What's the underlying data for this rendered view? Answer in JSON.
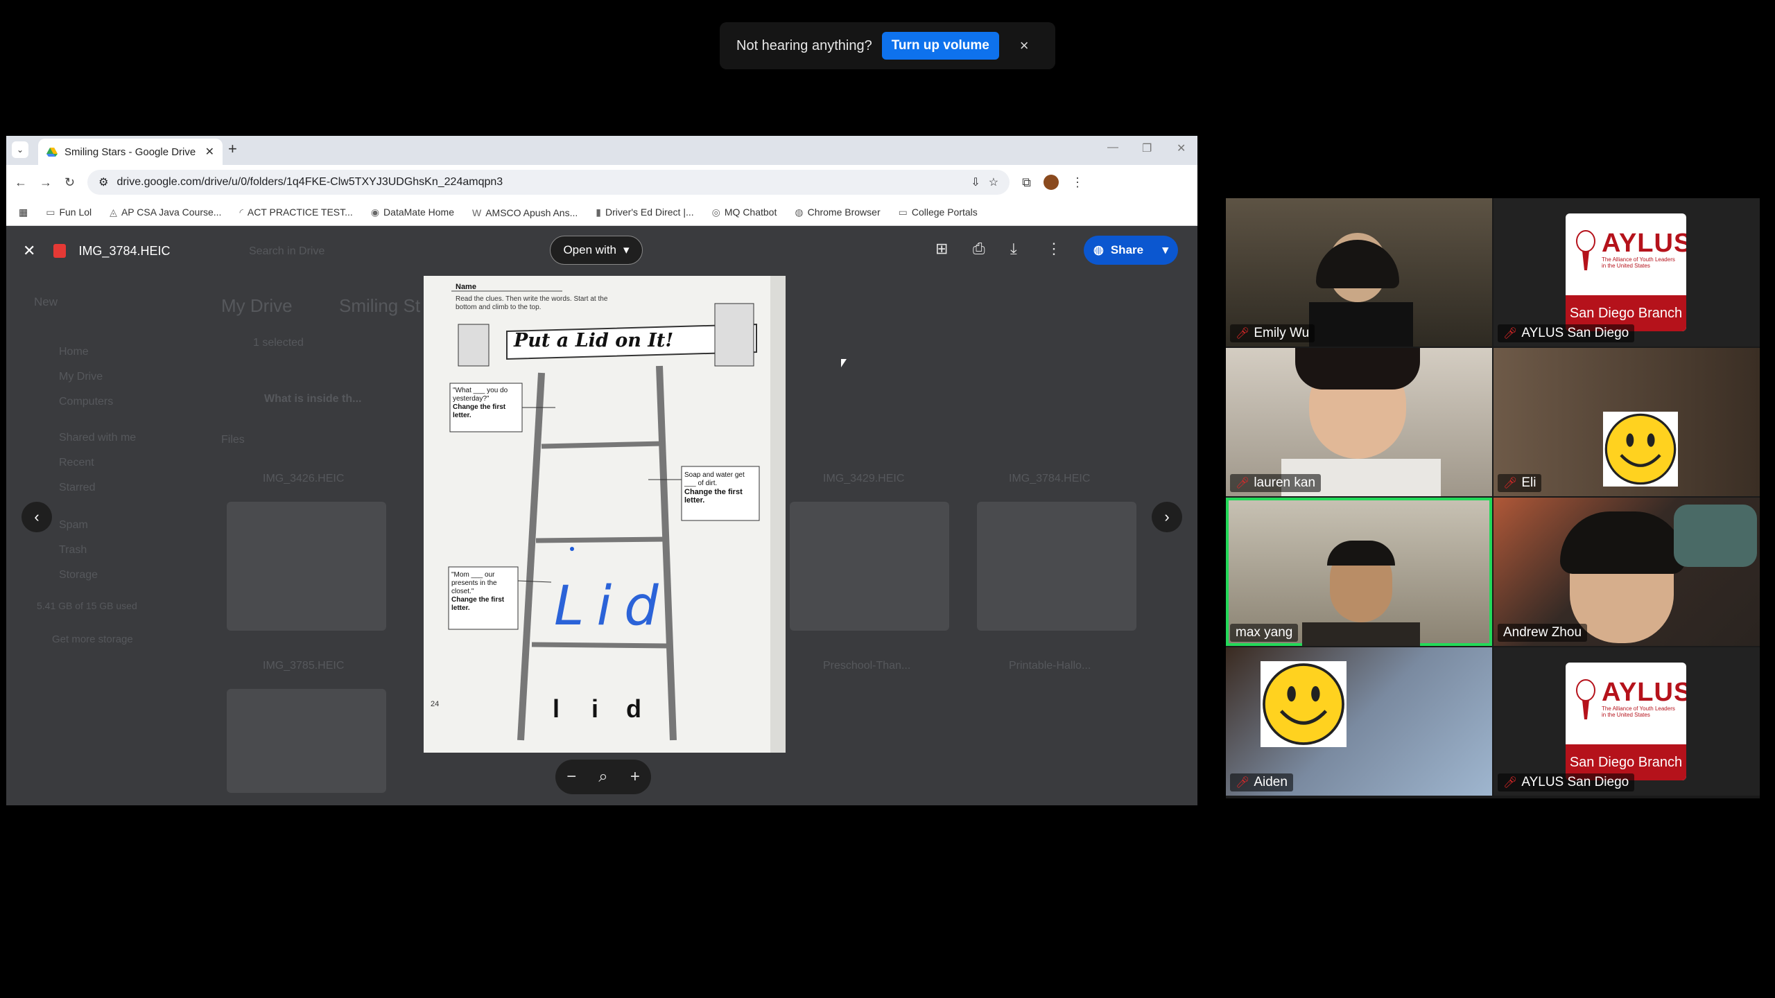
{
  "notification": {
    "message": "Not hearing anything?",
    "action": "Turn up volume",
    "close": "×"
  },
  "browser": {
    "tab_title": "Smiling Stars - Google Drive",
    "url": "drive.google.com/drive/u/0/folders/1q4FKE-Clw5TXYJ3UDGhsKn_224amqpn3",
    "bookmarks": [
      "Fun Lol",
      "AP CSA Java Course...",
      "ACT PRACTICE TEST...",
      "DataMate Home",
      "AMSCO Apush Ans...",
      "Driver's Ed Direct |...",
      "MQ Chatbot",
      "Chrome Browser",
      "College Portals"
    ]
  },
  "drive": {
    "bg": {
      "new": "New",
      "search": "Search in Drive",
      "crumb1": "My Drive",
      "crumb2": "Smiling St",
      "nav": [
        "Home",
        "My Drive",
        "Computers",
        "Shared with me",
        "Recent",
        "Starred",
        "Spam",
        "Trash",
        "Storage"
      ],
      "storage": "5.41 GB of 15 GB used",
      "get_storage": "Get more storage",
      "selected": "1 selected",
      "folder": "What is inside th...",
      "files_label": "Files",
      "files": [
        "IMG_3426.HEIC",
        "IMG_3429.HEIC",
        "IMG_3784.HEIC",
        "IMG_3785.HEIC",
        "Preschool-Than...",
        "Printable-Hallo..."
      ]
    },
    "viewer": {
      "file_name": "IMG_3784.HEIC",
      "open_with": "Open with",
      "share": "Share"
    },
    "worksheet": {
      "name_label": "Name",
      "instructions": "Read the clues. Then write the words. Start at the bottom and climb to the top.",
      "title": "Put a Lid on It!",
      "clue1_a": "\"What ___ you do yesterday?\"",
      "clue1_b": "Change the first letter.",
      "clue2_a": "Soap and water get ___ of dirt.",
      "clue2_b": "Change the first letter.",
      "clue3_a": "\"Mom ___ our presents in the closet.\"",
      "clue3_b": "Change the first letter.",
      "handwritten": "Lid",
      "letters": [
        "l",
        "i",
        "d"
      ],
      "page_number": "24"
    }
  },
  "participants": [
    {
      "name": "Emily Wu",
      "type": "video"
    },
    {
      "name": "AYLUS San Diego",
      "type": "logo"
    },
    {
      "name": "lauren kan",
      "type": "video"
    },
    {
      "name": "Eli",
      "type": "smiley"
    },
    {
      "name": "max yang",
      "type": "video",
      "active": true
    },
    {
      "name": "Andrew Zhou",
      "type": "video"
    },
    {
      "name": "Aiden",
      "type": "smiley"
    },
    {
      "name": "AYLUS San Diego",
      "type": "logo"
    }
  ],
  "aylus_logo": {
    "brand": "AYLUS",
    "tagline": "The Alliance of Youth Leaders in the United States",
    "branch": "San Diego Branch"
  }
}
